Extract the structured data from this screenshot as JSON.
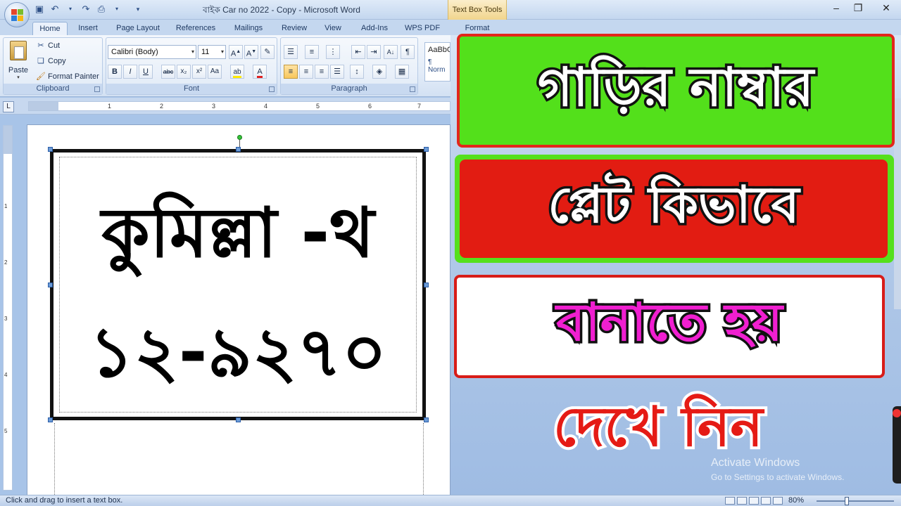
{
  "window": {
    "title": "বাইক Car no 2022 - Copy - Microsoft Word",
    "context_tab": "Text Box Tools"
  },
  "ribbon": {
    "tabs": [
      "Home",
      "Insert",
      "Page Layout",
      "References",
      "Mailings",
      "Review",
      "View",
      "Add-Ins",
      "WPS PDF",
      "Format"
    ],
    "active_tab": "Home",
    "clipboard": {
      "paste": "Paste",
      "cut": "Cut",
      "copy": "Copy",
      "format_painter": "Format Painter",
      "label": "Clipboard"
    },
    "font": {
      "name": "Calibri (Body)",
      "size": "11",
      "label": "Font"
    },
    "paragraph": {
      "label": "Paragraph"
    },
    "styles": {
      "sample": "AaBbC",
      "normal": "¶ Norm"
    }
  },
  "ruler": {
    "tab_selector": "L",
    "h_numbers": [
      "1",
      "2",
      "3",
      "4",
      "5",
      "6",
      "7"
    ],
    "v_numbers": [
      "1",
      "2",
      "3",
      "4",
      "5"
    ]
  },
  "document": {
    "line1": "কুমিল্লা -থ",
    "line2": "১২-৯২৭০"
  },
  "banner": {
    "line1": "গাড়ির নাম্বার",
    "line2": "প্লেট কিভাবে",
    "line3": "বানাতে হয়",
    "line4": "দেখে নিন"
  },
  "watermark": {
    "line1": "Activate Windows",
    "line2": "Go to Settings to activate Windows."
  },
  "status": {
    "text": "Click and drag to insert a text box.",
    "zoom": "80%"
  },
  "colors": {
    "banner_green": "#53e01b",
    "banner_red": "#e21c12",
    "banner_magenta": "#f01fd0"
  }
}
